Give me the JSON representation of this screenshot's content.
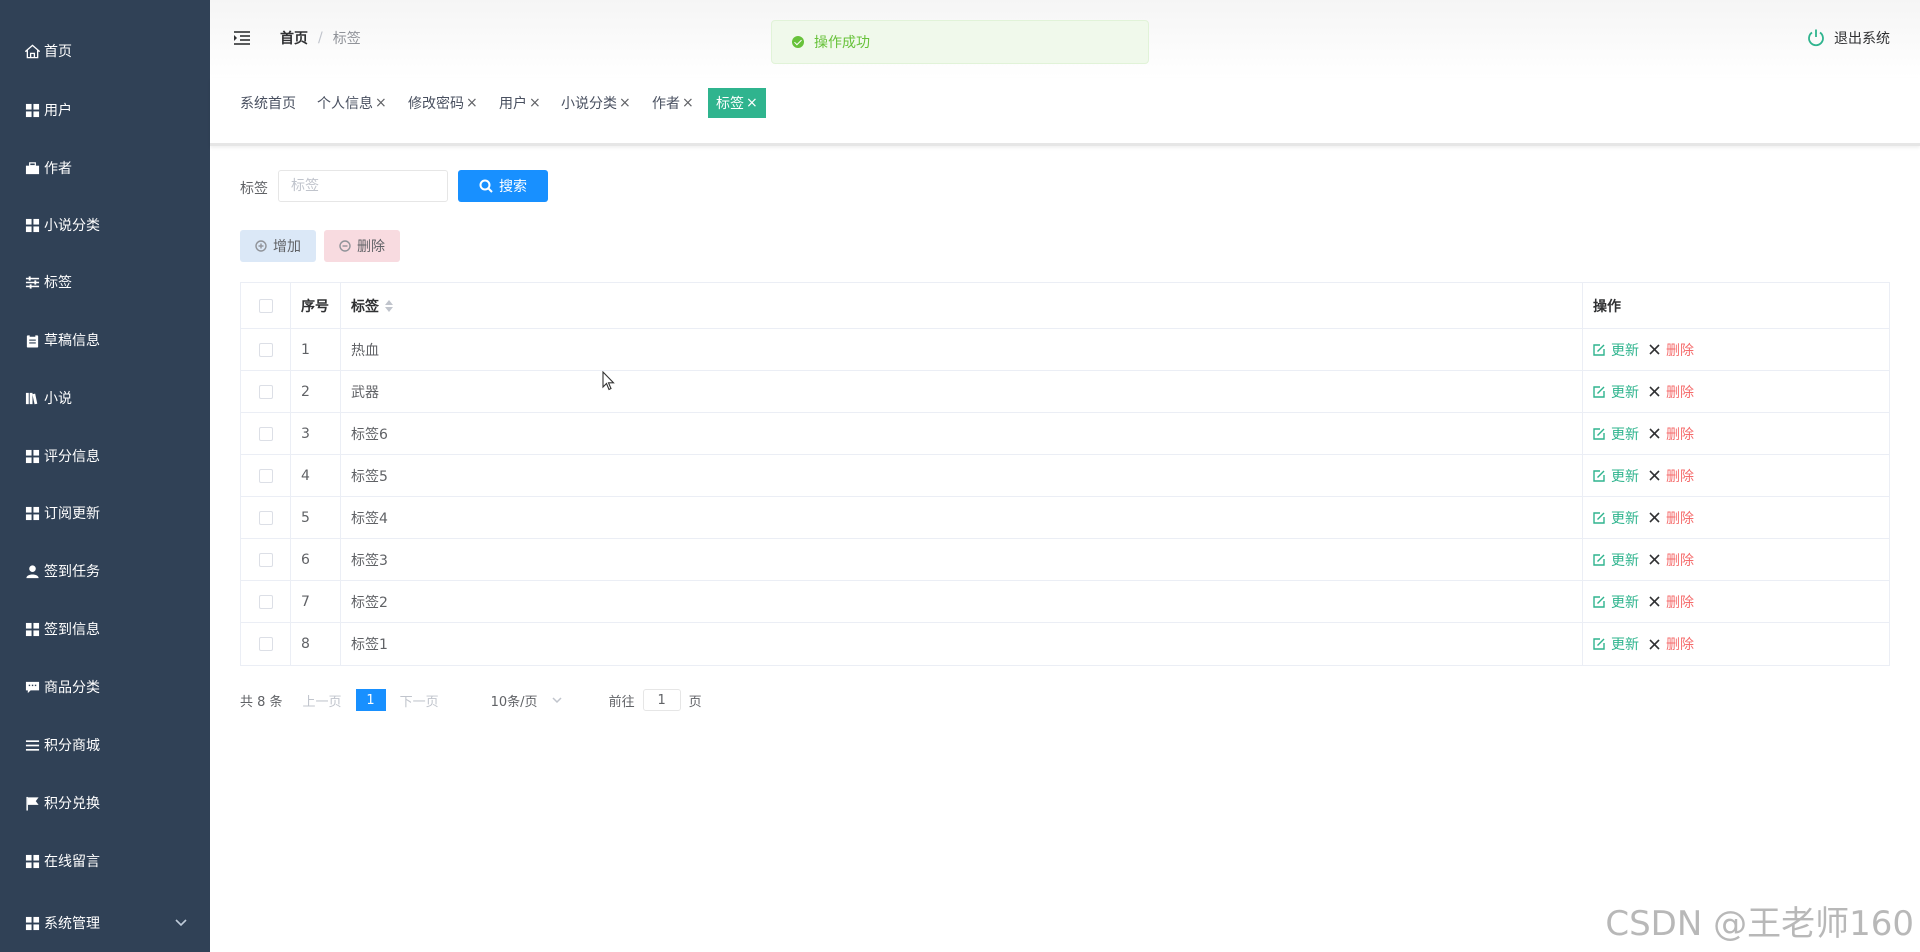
{
  "sidebar": {
    "items": [
      {
        "label": "首页",
        "icon": "home-icon"
      },
      {
        "label": "用户",
        "icon": "grid-icon"
      },
      {
        "label": "作者",
        "icon": "briefcase-icon"
      },
      {
        "label": "小说分类",
        "icon": "grid-icon"
      },
      {
        "label": "标签",
        "icon": "sliders-icon"
      },
      {
        "label": "草稿信息",
        "icon": "clipboard-icon"
      },
      {
        "label": "小说",
        "icon": "books-icon"
      },
      {
        "label": "评分信息",
        "icon": "grid-icon"
      },
      {
        "label": "订阅更新",
        "icon": "grid-icon"
      },
      {
        "label": "签到任务",
        "icon": "user-icon"
      },
      {
        "label": "签到信息",
        "icon": "grid-icon"
      },
      {
        "label": "商品分类",
        "icon": "chat-icon"
      },
      {
        "label": "积分商城",
        "icon": "list-icon"
      },
      {
        "label": "积分兑换",
        "icon": "flag-icon"
      },
      {
        "label": "在线留言",
        "icon": "grid-icon"
      },
      {
        "label": "系统管理",
        "icon": "grid-icon"
      }
    ]
  },
  "header": {
    "breadcrumb": {
      "home": "首页",
      "current": "标签"
    },
    "logout_label": "退出系统"
  },
  "toast": {
    "message": "操作成功"
  },
  "tags": [
    {
      "label": "系统首页",
      "closable": false
    },
    {
      "label": "个人信息",
      "closable": true
    },
    {
      "label": "修改密码",
      "closable": true
    },
    {
      "label": "用户",
      "closable": true
    },
    {
      "label": "小说分类",
      "closable": true
    },
    {
      "label": "作者",
      "closable": true
    },
    {
      "label": "标签",
      "closable": true,
      "active": true
    }
  ],
  "search": {
    "label": "标签",
    "placeholder": "标签",
    "button_label": "搜索"
  },
  "actions": {
    "add_label": "增加",
    "delete_label": "删除"
  },
  "table": {
    "columns": {
      "index": "序号",
      "tag": "标签",
      "ops": "操作"
    },
    "op_edit": "更新",
    "op_delete": "删除",
    "rows": [
      {
        "index": "1",
        "tag": "热血"
      },
      {
        "index": "2",
        "tag": "武器"
      },
      {
        "index": "3",
        "tag": "标签6"
      },
      {
        "index": "4",
        "tag": "标签5"
      },
      {
        "index": "5",
        "tag": "标签4"
      },
      {
        "index": "6",
        "tag": "标签3"
      },
      {
        "index": "7",
        "tag": "标签2"
      },
      {
        "index": "8",
        "tag": "标签1"
      }
    ]
  },
  "pagination": {
    "total_text": "共 8 条",
    "prev_label": "上一页",
    "current_page": "1",
    "next_label": "下一页",
    "page_size": "10条/页",
    "goto_label": "前往",
    "goto_value": "1",
    "page_suffix": "页"
  },
  "watermark": "CSDN @王老师160",
  "colors": {
    "sidebar_bg": "#304156",
    "accent": "#2fb48e",
    "primary": "#1890ff",
    "danger": "#f56c6c",
    "toast_bg": "#f0f9eb"
  }
}
